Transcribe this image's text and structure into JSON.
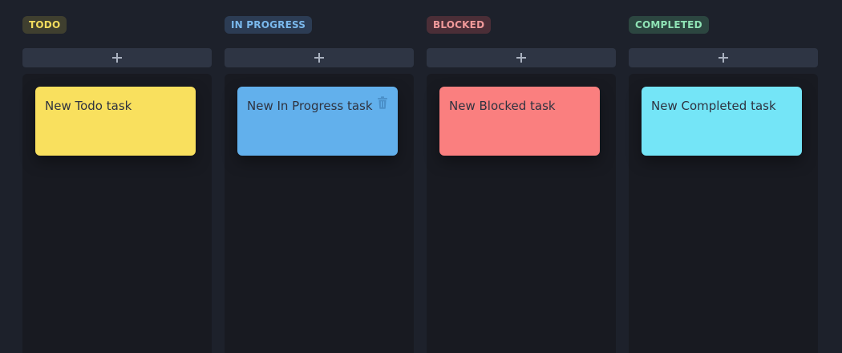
{
  "columns": [
    {
      "status": "TODO",
      "status_color": "#f2dc5d",
      "add_icon": "plus-icon",
      "cards": [
        {
          "title": "New Todo task",
          "color": "#f9e05e"
        }
      ]
    },
    {
      "status": "IN PROGRESS",
      "status_color": "#7ab8ec",
      "add_icon": "plus-icon",
      "cards": [
        {
          "title": "New In Progress task",
          "color": "#62b0ec",
          "action_icon": "trash-icon"
        }
      ]
    },
    {
      "status": "BLOCKED",
      "status_color": "#f19a9a",
      "add_icon": "plus-icon",
      "cards": [
        {
          "title": "New Blocked task",
          "color": "#fa7f7f"
        }
      ]
    },
    {
      "status": "COMPLETED",
      "status_color": "#8fe3b5",
      "add_icon": "plus-icon",
      "cards": [
        {
          "title": "New Completed task",
          "color": "#74e5f7"
        }
      ]
    }
  ]
}
